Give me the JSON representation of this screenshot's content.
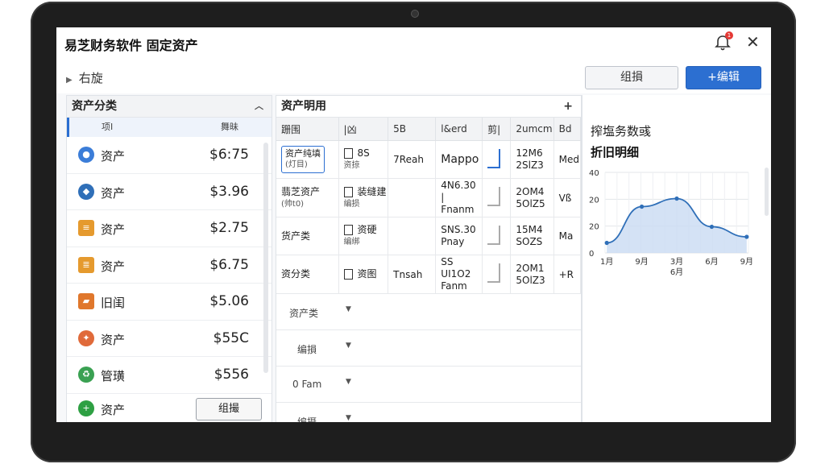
{
  "app": {
    "title": "易芝财务软件 固定资产",
    "notification_count": "1"
  },
  "toolbar": {
    "crumb": "右旋",
    "edit_label": "组損",
    "add_label": "+编辑"
  },
  "left_panel": {
    "title": "资产分类",
    "col_name": "项I",
    "col_value": "舞昧",
    "items": [
      {
        "name": "资产",
        "value": "$6:75",
        "icon": "globe-icon",
        "color": "#3b7dd8"
      },
      {
        "name": "资产",
        "value": "$3.96",
        "icon": "shield-icon",
        "color": "#2f6fb8"
      },
      {
        "name": "资产",
        "value": "$2.75",
        "icon": "list-icon",
        "color": "#e59a2e"
      },
      {
        "name": "资产",
        "value": "$6.75",
        "icon": "doc-icon",
        "color": "#e59a2e"
      },
      {
        "name": "旧闺",
        "value": "$5.06",
        "icon": "folder-icon",
        "color": "#e0772c"
      },
      {
        "name": "资产",
        "value": "$55C",
        "icon": "badge-icon",
        "color": "#e06a3a"
      },
      {
        "name": "管璜",
        "value": "$556",
        "icon": "recycle-icon",
        "color": "#3aa152"
      },
      {
        "name": "资产",
        "value": "",
        "icon": "plus-circle-icon",
        "color": "#2ea043"
      }
    ],
    "row_edit_label": "组撮"
  },
  "mid_panel": {
    "title": "资产明用",
    "headers": [
      "跚围",
      "|凶",
      "5B",
      "l&erd",
      "剪|",
      "2umcm",
      "Bd"
    ],
    "rows": [
      {
        "c1a": "资产纯填",
        "c1b": "(灯目)",
        "c2a": "8S",
        "c2b": "资掠",
        "c3": "7Reah",
        "c4a": "Mappo",
        "c4b": "",
        "c6a": "12M6",
        "c6b": "2SlZ3",
        "c7": "Med"
      },
      {
        "c1a": "翡芝资产",
        "c1b": "(帅t0)",
        "c2a": "装缝建",
        "c2b": "编损",
        "c3": "",
        "c4a": "4N6.30 |",
        "c4b": "Fnanm",
        "c6a": "2OM4",
        "c6b": "5OlZ5",
        "c7": "Vß"
      },
      {
        "c1a": "货产类",
        "c1b": "",
        "c2a": "资硬",
        "c2b": "编绑",
        "c3": "",
        "c4a": "SNS.30",
        "c4b": "Pnay",
        "c6a": "15M4",
        "c6b": "SOZS",
        "c7": "Ma"
      },
      {
        "c1a": "资分类",
        "c1b": "",
        "c2a": "资图",
        "c2b": "",
        "c3": "Tnsah",
        "c4a": "SS UI1O2",
        "c4b": "Fanm",
        "c6a": "2OM1",
        "c6b": "5OlZ3",
        "c7": "+R"
      }
    ],
    "list": [
      "资产类",
      "编損",
      "0 Fam",
      "编摄"
    ]
  },
  "right_panel": {
    "title": "搾塩务数彧",
    "subtitle": "折旧明细"
  },
  "chart_data": {
    "type": "area",
    "categories": [
      "1月",
      "9月",
      "3月",
      "6月",
      "9月"
    ],
    "x_extra_label": "6月",
    "values": [
      5,
      23,
      27,
      13,
      8
    ],
    "ylim": [
      0,
      40
    ],
    "yticks": [
      "40",
      "20",
      "20",
      "0"
    ],
    "grid": true,
    "colors": {
      "line": "#2f6fb8",
      "fill": "#c9dbf2",
      "point": "#2f6fb8"
    }
  }
}
